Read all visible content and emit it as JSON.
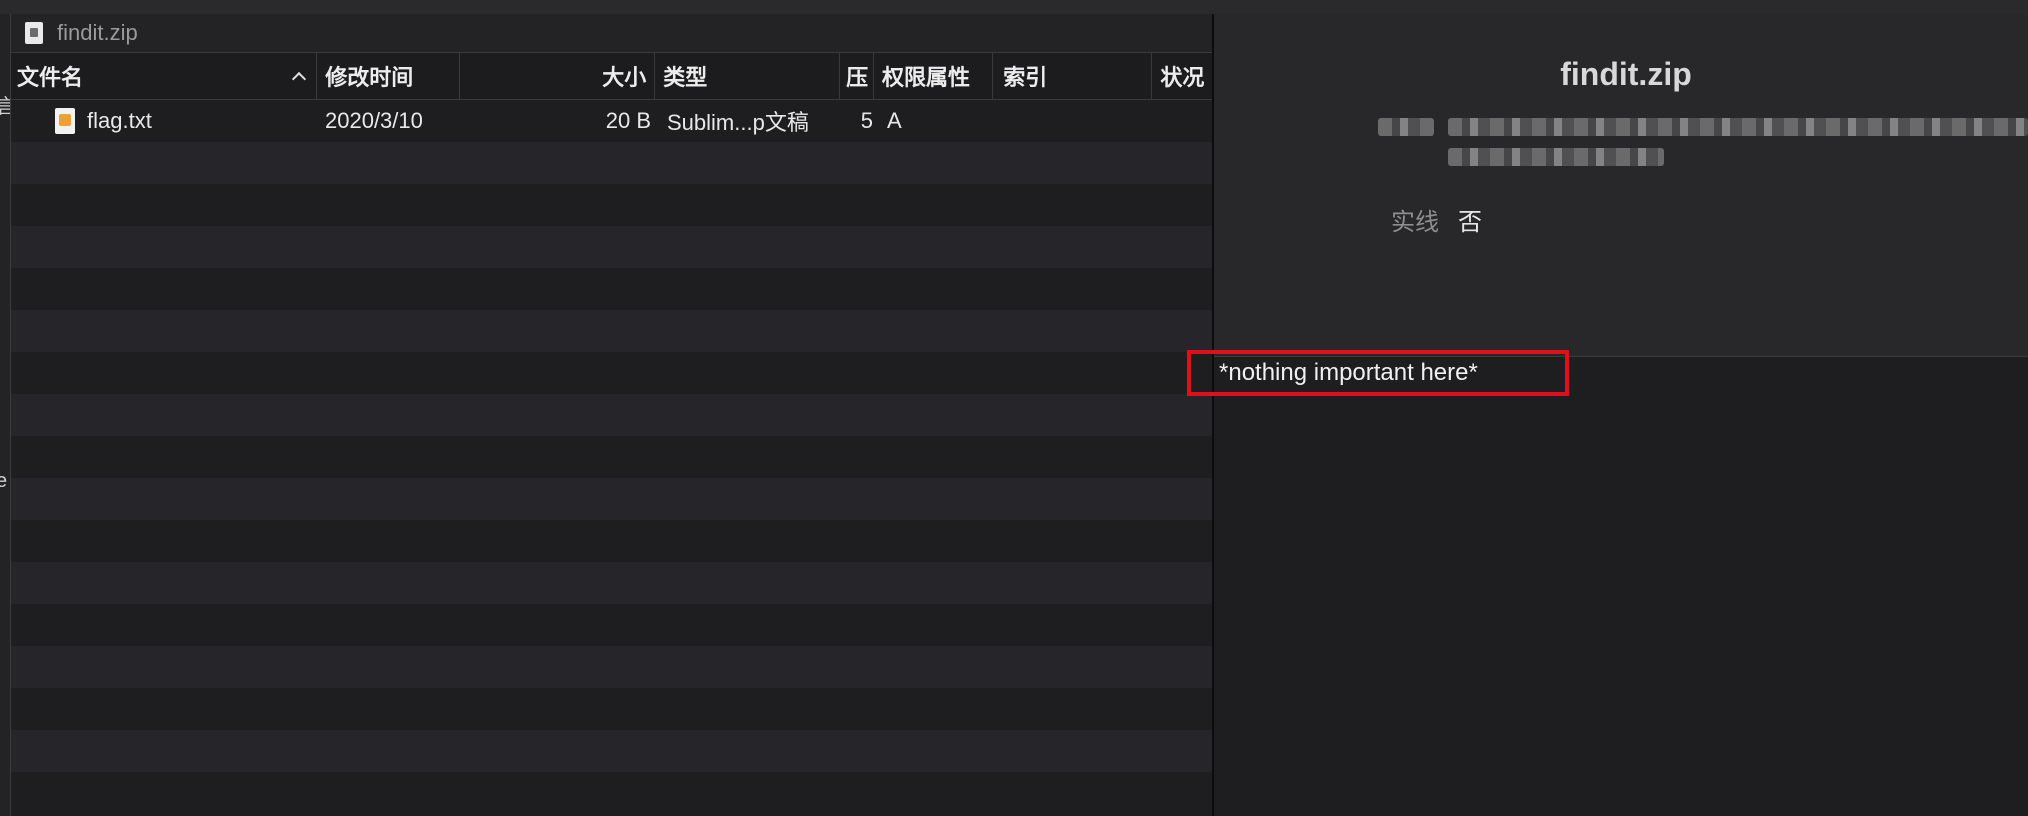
{
  "archive": {
    "path_label": "findit.zip"
  },
  "columns": [
    {
      "key": "name",
      "label": "文件名"
    },
    {
      "key": "date",
      "label": "修改时间"
    },
    {
      "key": "size",
      "label": "大小"
    },
    {
      "key": "type",
      "label": "类型"
    },
    {
      "key": "ratio",
      "label": "压"
    },
    {
      "key": "perm",
      "label": "权限属性"
    },
    {
      "key": "index",
      "label": "索引"
    },
    {
      "key": "status",
      "label": "状况"
    }
  ],
  "files": [
    {
      "name": "flag.txt",
      "date": "2020/3/10",
      "size": "20 B",
      "type": "Sublim...p文稿",
      "ratio": "5",
      "perm": "A",
      "icon": "sublime-text-file-icon"
    }
  ],
  "left_cut": {
    "chars": [
      "言",
      "e",
      "."
    ]
  },
  "info": {
    "title": "findit.zip",
    "solid_label": "实线",
    "solid_value": "否"
  },
  "comment": {
    "text": "*nothing important here*",
    "highlight_color": "#e0101a"
  },
  "icons": {
    "archive": "zip-file-icon",
    "sort": "chevron-up-icon"
  }
}
